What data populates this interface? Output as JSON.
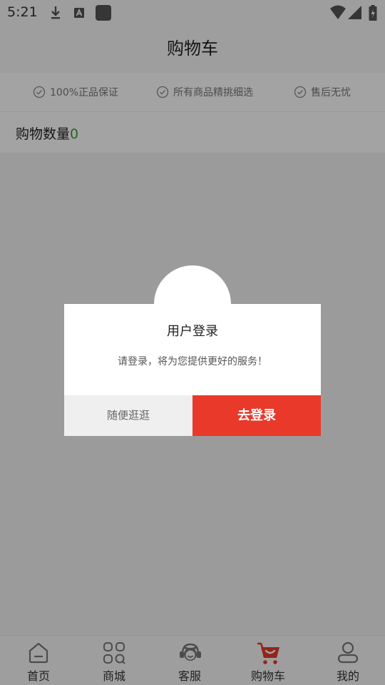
{
  "status_bar": {
    "time": "5:21",
    "icons": [
      "download-icon",
      "a-icon",
      "app-icon",
      "wifi-icon",
      "signal-icon",
      "battery-icon"
    ]
  },
  "header": {
    "title": "购物车"
  },
  "guarantees": {
    "items": [
      {
        "icon": "check-circle-icon",
        "label": "100%正品保证"
      },
      {
        "icon": "check-circle-icon",
        "label": "所有商品精挑细选"
      },
      {
        "icon": "check-circle-icon",
        "label": "售后无忧"
      }
    ]
  },
  "cart": {
    "count_label": "购物数量",
    "count": "0"
  },
  "dialog": {
    "title": "用户登录",
    "message": "请登录，将为您提供更好的服务！",
    "browse_label": "随便逛逛",
    "login_label": "去登录"
  },
  "tab_bar": {
    "items": [
      {
        "icon": "home-icon",
        "label": "首页"
      },
      {
        "icon": "grid-icon",
        "label": "商城"
      },
      {
        "icon": "customer-service-icon",
        "label": "客服"
      },
      {
        "icon": "cart-icon",
        "label": "购物车"
      },
      {
        "icon": "user-icon",
        "label": "我的"
      }
    ],
    "active_index": 3
  },
  "colors": {
    "accent": "#e8392a",
    "count_green": "#3aa03a",
    "overlay": "rgba(0,0,0,0.36)"
  }
}
